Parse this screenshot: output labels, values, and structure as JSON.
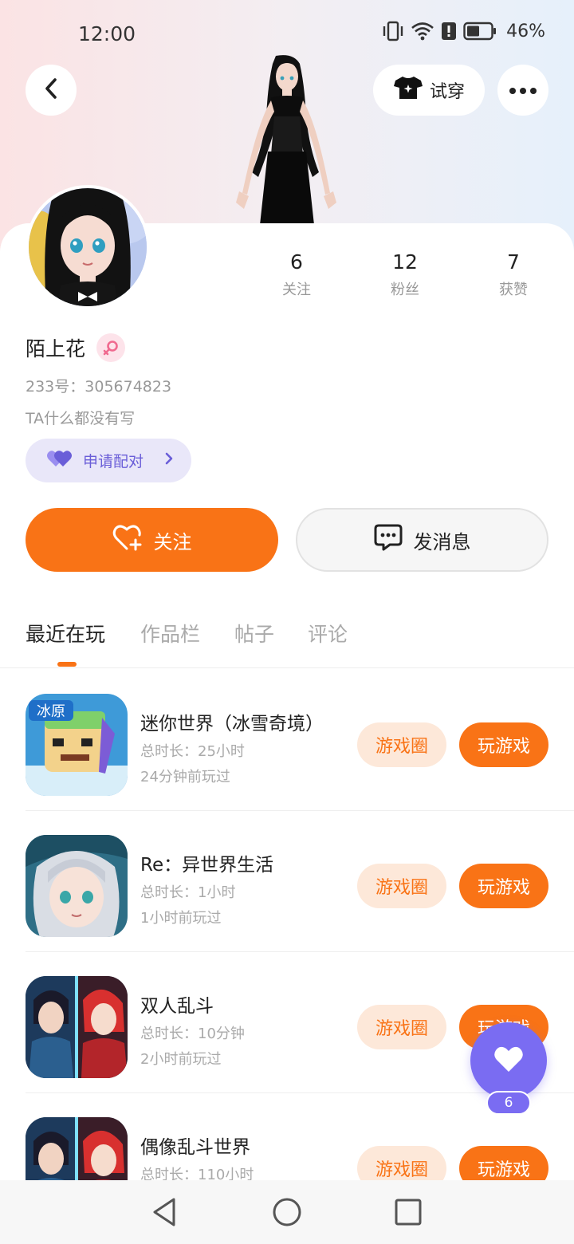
{
  "status_bar": {
    "time": "12:00",
    "battery_percent": "46%",
    "icons": [
      "vibrate-icon",
      "wifi-icon",
      "alert-icon",
      "battery-icon"
    ]
  },
  "header": {
    "try_on_label": "试穿",
    "icons": [
      "back-icon",
      "shirt-icon",
      "more-icon"
    ]
  },
  "profile": {
    "username": "陌上花",
    "gender": "female",
    "uid": "233号：305674823",
    "bio": "TA什么都没有写",
    "pair_label": "申请配对",
    "stats": [
      {
        "value": "6",
        "label": "关注"
      },
      {
        "value": "12",
        "label": "粉丝"
      },
      {
        "value": "7",
        "label": "获赞"
      }
    ]
  },
  "actions": {
    "follow_label": "关注",
    "message_label": "发消息"
  },
  "tabs": [
    {
      "label": "最近在玩",
      "active": true
    },
    {
      "label": "作品栏",
      "active": false
    },
    {
      "label": "帖子",
      "active": false
    },
    {
      "label": "评论",
      "active": false
    }
  ],
  "games": [
    {
      "title": "迷你世界（冰雪奇境）",
      "duration": "总时长：25小时",
      "last_played": "24分钟前玩过",
      "circle_label": "游戏圈",
      "play_label": "玩游戏"
    },
    {
      "title": "Re：异世界生活",
      "duration": "总时长：1小时",
      "last_played": "1小时前玩过",
      "circle_label": "游戏圈",
      "play_label": "玩游戏"
    },
    {
      "title": "双人乱斗",
      "duration": "总时长：10分钟",
      "last_played": "2小时前玩过",
      "circle_label": "游戏圈",
      "play_label": "玩游戏"
    },
    {
      "title": "偶像乱斗世界",
      "duration": "总时长：110小时",
      "last_played": "",
      "circle_label": "游戏圈",
      "play_label": "玩游戏"
    }
  ],
  "game_icon_labels": {
    "mini_world_badge": "冰原"
  },
  "floating_like": {
    "count": "6"
  },
  "colors": {
    "accent": "#f97316",
    "accent_soft": "#fde8d9",
    "purple": "#7a6cf2",
    "pair_bg": "#e9e7f9"
  }
}
